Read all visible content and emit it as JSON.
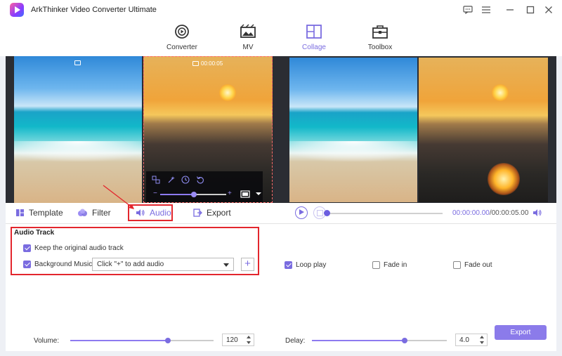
{
  "app": {
    "title": "ArkThinker Video Converter Ultimate"
  },
  "nav": {
    "tabs": [
      {
        "label": "Converter",
        "icon": "converter-icon",
        "active": false
      },
      {
        "label": "MV",
        "icon": "mv-icon",
        "active": false
      },
      {
        "label": "Collage",
        "icon": "collage-icon",
        "active": true
      },
      {
        "label": "Toolbox",
        "icon": "toolbox-icon",
        "active": false
      }
    ]
  },
  "preview": {
    "selected_clip_time": "00:00:05"
  },
  "edit_tabs": [
    {
      "label": "Template",
      "icon": "template-icon",
      "active": false
    },
    {
      "label": "Filter",
      "icon": "filter-icon",
      "active": false
    },
    {
      "label": "Audio",
      "icon": "audio-icon",
      "active": true
    },
    {
      "label": "Export",
      "icon": "export-icon",
      "active": false
    }
  ],
  "player": {
    "current_time": "00:00:00.00",
    "total_time": "/00:00:05.00",
    "progress": 0
  },
  "audio": {
    "section_title": "Audio Track",
    "keep_original_label": "Keep the original audio track",
    "keep_original_checked": true,
    "bg_music_label": "Background Music",
    "bg_music_checked": true,
    "bg_music_placeholder": "Click \"+\" to add audio",
    "add_button": "+",
    "volume_label": "Volume:",
    "volume_value": "120",
    "volume_fraction": 0.68,
    "loop_play_label": "Loop play",
    "loop_play_checked": true,
    "fade_in_label": "Fade in",
    "fade_in_checked": false,
    "fade_out_label": "Fade out",
    "fade_out_checked": false,
    "delay_label": "Delay:",
    "delay_value": "4.0",
    "delay_fraction": 0.69
  },
  "export_button": "Export",
  "colors": {
    "accent": "#7a6ce0",
    "highlight": "#e3262d",
    "export_bg": "#8b7bea"
  }
}
